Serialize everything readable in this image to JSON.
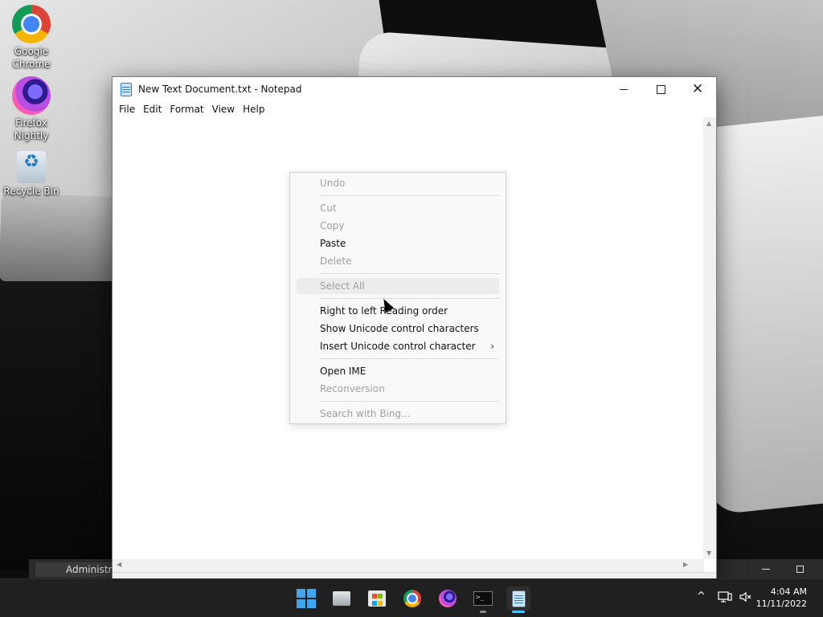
{
  "desktop": {
    "icons": [
      {
        "label": "Google Chrome"
      },
      {
        "label": "Firefox Nightly"
      },
      {
        "label": "Recycle Bin"
      }
    ]
  },
  "notepad": {
    "title": "New Text Document.txt - Notepad",
    "menu": [
      "File",
      "Edit",
      "Format",
      "View",
      "Help"
    ],
    "content": ""
  },
  "context_menu": {
    "items": [
      {
        "label": "Undo",
        "enabled": false
      },
      {
        "label": "Cut",
        "enabled": false
      },
      {
        "label": "Copy",
        "enabled": false
      },
      {
        "label": "Paste",
        "enabled": true
      },
      {
        "label": "Delete",
        "enabled": false
      },
      {
        "label": "Select All",
        "enabled": false
      },
      {
        "label": "Right to left Reading order",
        "enabled": true
      },
      {
        "label": "Show Unicode control characters",
        "enabled": true
      },
      {
        "label": "Insert Unicode control character",
        "enabled": true,
        "submenu_glyph": "›"
      },
      {
        "label": "Open IME",
        "enabled": true
      },
      {
        "label": "Reconversion",
        "enabled": false
      },
      {
        "label": "Search with Bing...",
        "enabled": false
      }
    ]
  },
  "background_window": {
    "tab_label": "Administra"
  },
  "taskbar": {
    "clock_time": "4:04 AM",
    "clock_date": "11/11/2022",
    "tray_chevron": "^",
    "accent_color": "#4cc2ff"
  }
}
